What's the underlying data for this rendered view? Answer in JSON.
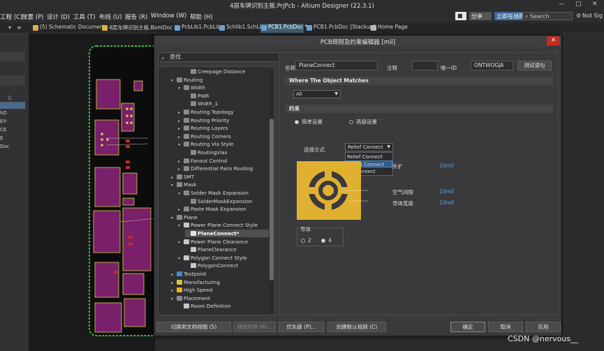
{
  "titlebar": {
    "title": "4层车牌识别主板.PrjPcb - Altium Designer (22.3.1)",
    "minimize": "—",
    "maximize": "□",
    "close": "✕"
  },
  "menubar": {
    "items": [
      "工程 (C)",
      "放置 (P)",
      "设计 (D)",
      "工具 (T)",
      "布线 (U)",
      "报告 (R)",
      "Window (W)",
      "帮助 (H)"
    ],
    "share": "分享",
    "buy": "立即在线购买",
    "search_placeholder": "Search",
    "signed": "Not Sig"
  },
  "tabs": [
    {
      "label": "(5) Schematic Document",
      "color": "#d9b34a"
    },
    {
      "label": "4层车牌识别主板.BomDoc",
      "color": "#d9b34a"
    },
    {
      "label": "PcbLib1.PcbLib",
      "color": "#6aa0d8"
    },
    {
      "label": "Schlib1.SchLib",
      "color": "#6aa0d8"
    },
    {
      "label": "PCB1.PcbDoc *",
      "color": "#6aa0d8",
      "active": true
    },
    {
      "label": "PCB1.PcbDoc [Stackup]",
      "color": "#6aa0d8"
    },
    {
      "label": "Home Page",
      "color": "#bbbbbb"
    }
  ],
  "leftpanel": {
    "labels": [
      "hD",
      "EY-",
      "CE",
      "E",
      "Doc"
    ]
  },
  "dialog": {
    "title": "PCB规则及约束编辑器 [mil]",
    "close": "✕",
    "search_placeholder": "查找",
    "tree": [
      {
        "label": "Creepage Distance",
        "indent": 3,
        "ex": "",
        "ic": "#8a8a8a"
      },
      {
        "label": "Routing",
        "indent": 1,
        "ex": "▾",
        "ic": "#8a8a8a"
      },
      {
        "label": "Width",
        "indent": 2,
        "ex": "▾",
        "ic": "#8a8a8a"
      },
      {
        "label": "PWR",
        "indent": 3,
        "ex": "",
        "ic": "#8a8a8a"
      },
      {
        "label": "Width_1",
        "indent": 3,
        "ex": "",
        "ic": "#8a8a8a"
      },
      {
        "label": "Routing Topology",
        "indent": 2,
        "ex": "▸",
        "ic": "#8a8a8a"
      },
      {
        "label": "Routing Priority",
        "indent": 2,
        "ex": "▸",
        "ic": "#8a8a8a"
      },
      {
        "label": "Routing Layers",
        "indent": 2,
        "ex": "▸",
        "ic": "#8a8a8a"
      },
      {
        "label": "Routing Corners",
        "indent": 2,
        "ex": "▸",
        "ic": "#8a8a8a"
      },
      {
        "label": "Routing Via Style",
        "indent": 2,
        "ex": "▾",
        "ic": "#8a8a8a"
      },
      {
        "label": "RoutingVias",
        "indent": 3,
        "ex": "",
        "ic": "#8a8a8a"
      },
      {
        "label": "Fanout Control",
        "indent": 2,
        "ex": "▸",
        "ic": "#8a8a8a"
      },
      {
        "label": "Differential Pairs Routing",
        "indent": 2,
        "ex": "▸",
        "ic": "#8a8a8a"
      },
      {
        "label": "SMT",
        "indent": 1,
        "ex": "▸",
        "ic": "#8a8a8a"
      },
      {
        "label": "Mask",
        "indent": 1,
        "ex": "▾",
        "ic": "#8a8a8a"
      },
      {
        "label": "Solder Mask Expansion",
        "indent": 2,
        "ex": "▾",
        "ic": "#8a8a8a"
      },
      {
        "label": "SolderMaskExpansion",
        "indent": 3,
        "ex": "",
        "ic": "#8a8a8a"
      },
      {
        "label": "Paste Mask Expansion",
        "indent": 2,
        "ex": "▸",
        "ic": "#8a8a8a"
      },
      {
        "label": "Plane",
        "indent": 1,
        "ex": "▾",
        "ic": "#8a8a8a"
      },
      {
        "label": "Power Plane Connect Style",
        "indent": 2,
        "ex": "▾",
        "ic": "#c8c8c8"
      },
      {
        "label": "PlaneConnect*",
        "indent": 3,
        "ex": "",
        "ic": "#e0e0e0",
        "selected": true
      },
      {
        "label": "Power Plane Clearance",
        "indent": 2,
        "ex": "▾",
        "ic": "#c8c8c8"
      },
      {
        "label": "PlaneClearance",
        "indent": 3,
        "ex": "",
        "ic": "#c8c8c8"
      },
      {
        "label": "Polygon Connect Style",
        "indent": 2,
        "ex": "▾",
        "ic": "#c8c8c8"
      },
      {
        "label": "PolygonConnect",
        "indent": 3,
        "ex": "",
        "ic": "#c8c8c8"
      },
      {
        "label": "Testpoint",
        "indent": 1,
        "ex": "▸",
        "ic": "#4a86c8"
      },
      {
        "label": "Manufacturing",
        "indent": 1,
        "ex": "▸",
        "ic": "#d8c040"
      },
      {
        "label": "High Speed",
        "indent": 1,
        "ex": "▸",
        "ic": "#e8b020"
      },
      {
        "label": "Placement",
        "indent": 1,
        "ex": "▾",
        "ic": "#8a8a8a"
      },
      {
        "label": "Room Definition",
        "indent": 2,
        "ex": "",
        "ic": "#c8c8c8"
      }
    ],
    "content": {
      "name_label": "名称",
      "name_value": "PlaneConnect",
      "comment_label": "注释",
      "comment_value": "",
      "uid_label": "唯一ID",
      "uid_value": "ONTWOGJA",
      "test_button": "测试语句",
      "where_header": "Where The Object Matches",
      "scope_value": "All",
      "constraint_header": "约束",
      "radio_simple": "简单设置",
      "radio_advanced": "高级设置",
      "connect_label": "连接方式",
      "connect_value": "Relief Connect",
      "connect_options": [
        "Relief Connect",
        "Direct Connect",
        "No Connect"
      ],
      "expansion_label": "外扩",
      "expansion_value": "20mil",
      "air_gap_label": "空气间隙",
      "air_gap_value": "10mil",
      "conductor_width_label": "导体宽度",
      "conductor_width_value": "10mil",
      "conductors_label": "导体",
      "conductors_options": [
        "2",
        "4"
      ],
      "conductors_selected": "4"
    },
    "footer": {
      "switch_view": "切换到文档视图 (S)",
      "rule_wizard": "规则向导 (R)...",
      "priorities": "优先级 (P)...",
      "create_default": "创建默认规则 (C)",
      "ok": "确定",
      "cancel": "取消",
      "apply": "应用"
    }
  },
  "watermark": "CSDN @nervous__"
}
